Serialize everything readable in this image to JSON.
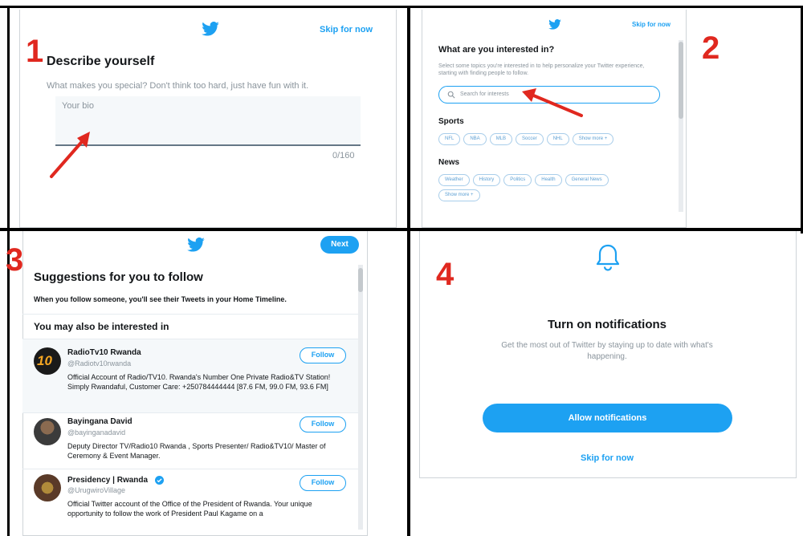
{
  "steps": {
    "one": "1",
    "two": "2",
    "three": "3",
    "four": "4"
  },
  "colors": {
    "brand": "#1da1f2",
    "step_number": "#e0281f",
    "arrow": "#e0281f"
  },
  "icons": [
    "twitter-bird-icon",
    "search-icon",
    "plus-icon",
    "verified-badge-icon",
    "bell-icon",
    "arrow-annotation"
  ],
  "panel1": {
    "skip_label": "Skip for now",
    "title": "Describe yourself",
    "subtitle": "What makes you special? Don't think too hard, just have fun with it.",
    "bio_placeholder": "Your bio",
    "char_count": "0/160"
  },
  "panel2": {
    "skip_label": "Skip for now",
    "title": "What are you interested in?",
    "subtitle": "Select some topics you're interested in to help personalize your Twitter experience, starting with finding people to follow.",
    "search_placeholder": "Search for interests",
    "sections": [
      {
        "title": "Sports",
        "chips": [
          "NFL",
          "NBA",
          "MLB",
          "Soccer",
          "NHL",
          "Show more +"
        ]
      },
      {
        "title": "News",
        "chips": [
          "Weather",
          "History",
          "Politics",
          "Health",
          "General News",
          "Show more +"
        ]
      }
    ]
  },
  "panel3": {
    "next_label": "Next",
    "title": "Suggestions for you to follow",
    "subtitle": "When you follow someone, you'll see their Tweets in your Home Timeline.",
    "section_title": "You may also be interested in",
    "follow_label": "Follow",
    "users": [
      {
        "name": "RadioTv10 Rwanda",
        "handle": "@Radiotv10rwanda",
        "bio": "Official Account of Radio/TV10. Rwanda's Number One Private Radio&TV Station! Simply Rwandaful, Customer Care: +250784444444 [87.6 FM, 99.0 FM, 93.6 FM]",
        "avatar_text": "10"
      },
      {
        "name": "Bayingana David",
        "handle": "@bayinganadavid",
        "bio": "Deputy Director TV/Radio10 Rwanda , Sports Presenter/ Radio&TV10/ Master of Ceremony & Event Manager."
      },
      {
        "name": "Presidency | Rwanda",
        "handle": "@UrugwiroVillage",
        "bio": "Official Twitter account of the Office of the President of Rwanda. Your unique opportunity to follow the work of President Paul Kagame on a"
      }
    ]
  },
  "panel4": {
    "title": "Turn on notifications",
    "subtitle": "Get the most out of Twitter by staying up to date with what's happening.",
    "allow_label": "Allow notifications",
    "skip_label": "Skip for now"
  }
}
